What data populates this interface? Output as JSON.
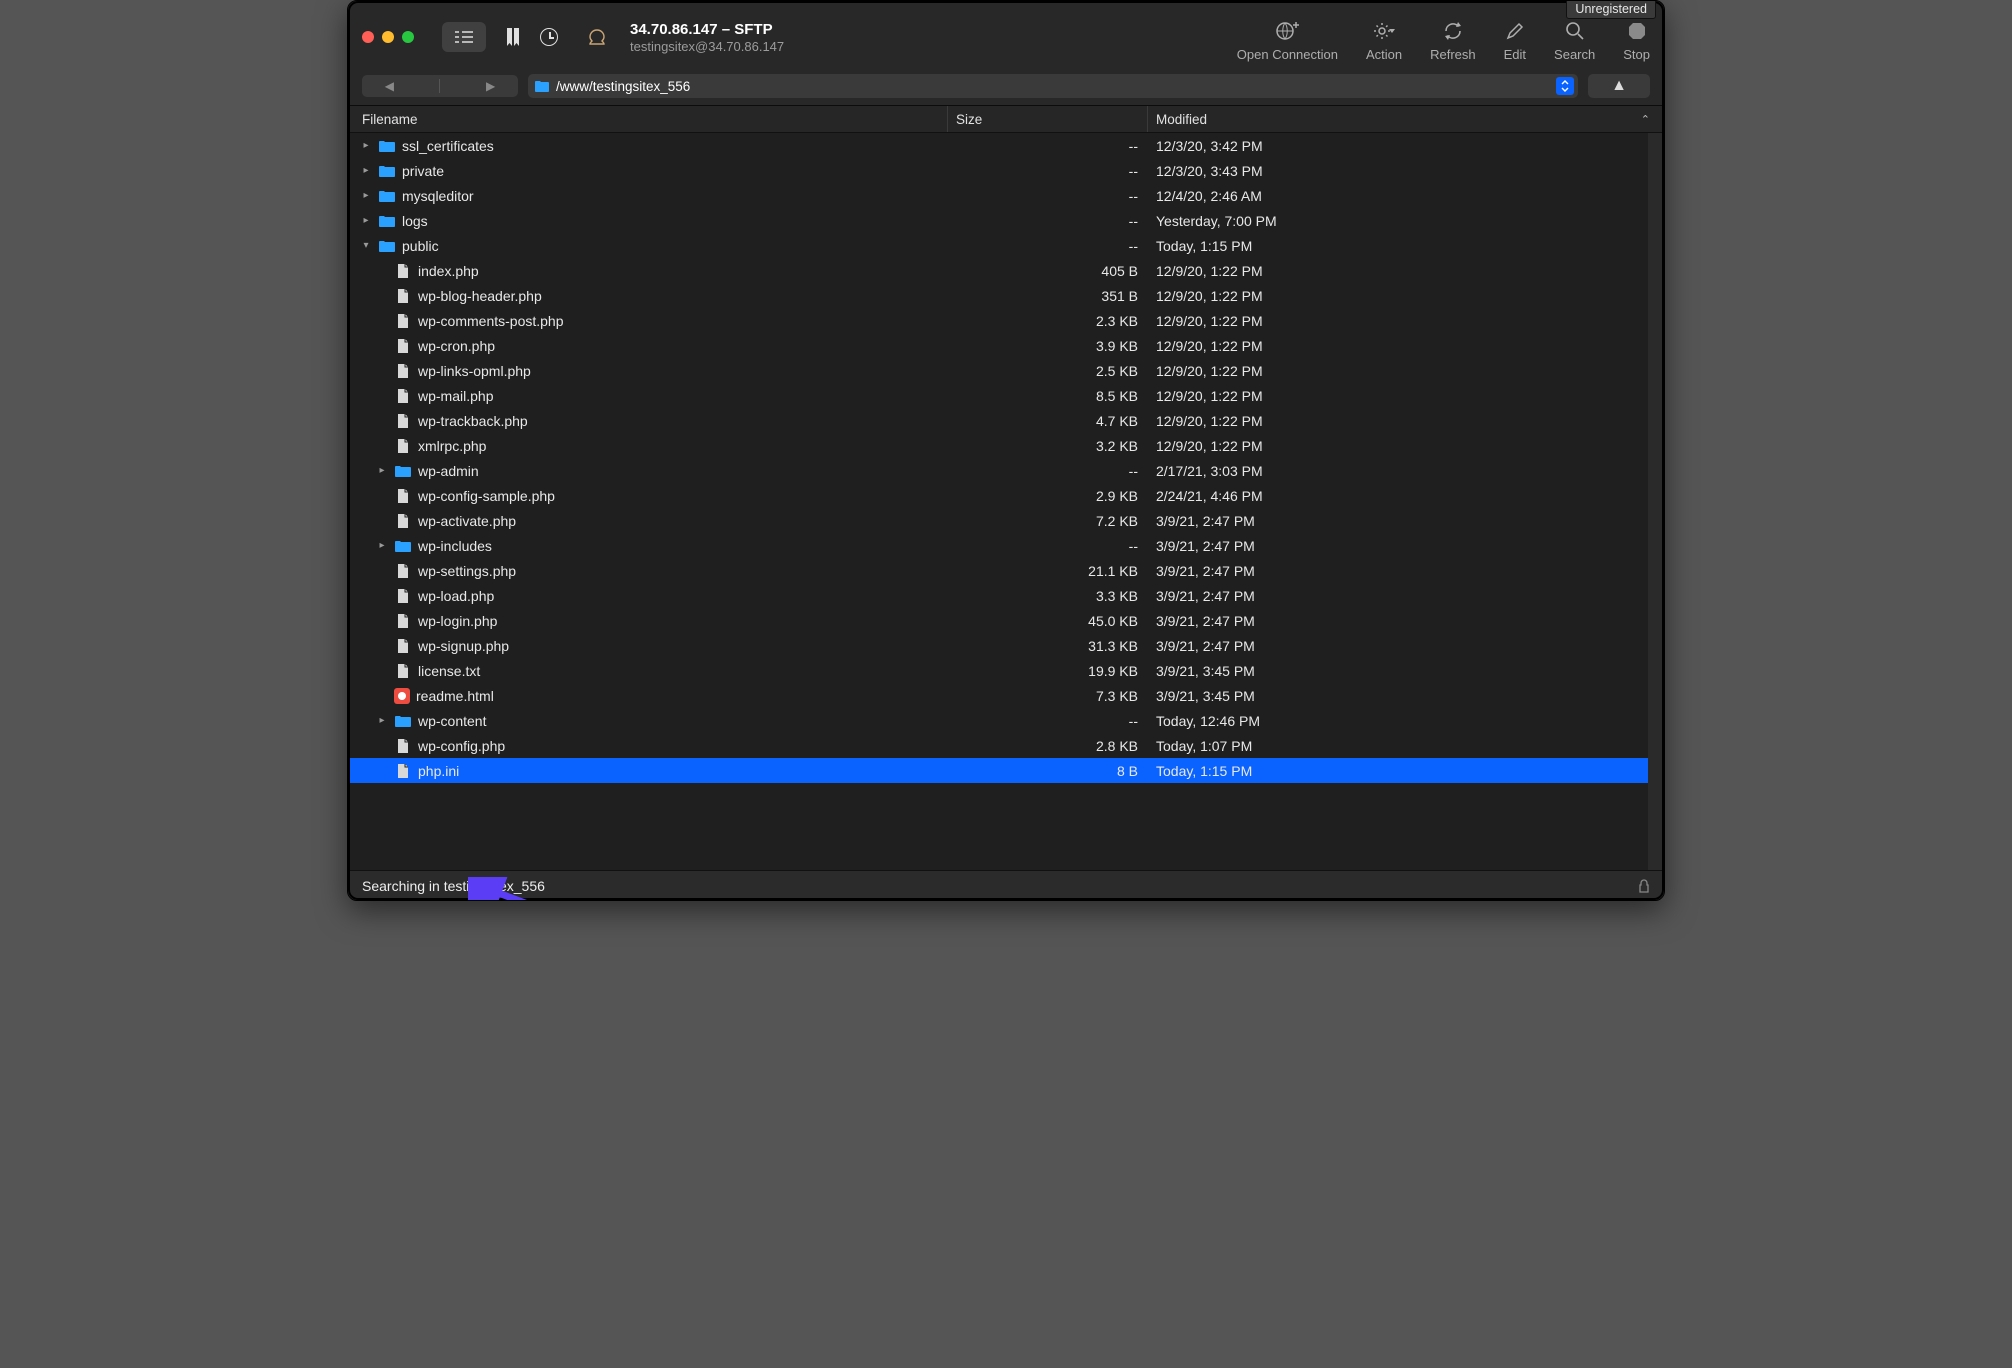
{
  "badge": "Unregistered",
  "header": {
    "title": "34.70.86.147 – SFTP",
    "subtitle": "testingsitex@34.70.86.147"
  },
  "actions": {
    "open_connection": "Open Connection",
    "action": "Action",
    "refresh": "Refresh",
    "edit": "Edit",
    "search": "Search",
    "stop": "Stop"
  },
  "path": "/www/testingsitex_556",
  "columns": {
    "filename": "Filename",
    "size": "Size",
    "modified": "Modified"
  },
  "rows": [
    {
      "type": "folder",
      "depth": 0,
      "expand": "closed",
      "name": "ssl_certificates",
      "size": "--",
      "mod": "12/3/20, 3:42 PM"
    },
    {
      "type": "folder",
      "depth": 0,
      "expand": "closed",
      "name": "private",
      "size": "--",
      "mod": "12/3/20, 3:43 PM"
    },
    {
      "type": "folder",
      "depth": 0,
      "expand": "closed",
      "name": "mysqleditor",
      "size": "--",
      "mod": "12/4/20, 2:46 AM"
    },
    {
      "type": "folder",
      "depth": 0,
      "expand": "closed",
      "name": "logs",
      "size": "--",
      "mod": "Yesterday, 7:00 PM"
    },
    {
      "type": "folder",
      "depth": 0,
      "expand": "open",
      "name": "public",
      "size": "--",
      "mod": "Today, 1:15 PM"
    },
    {
      "type": "file",
      "depth": 1,
      "name": "index.php",
      "size": "405 B",
      "mod": "12/9/20, 1:22 PM"
    },
    {
      "type": "file",
      "depth": 1,
      "name": "wp-blog-header.php",
      "size": "351 B",
      "mod": "12/9/20, 1:22 PM"
    },
    {
      "type": "file",
      "depth": 1,
      "name": "wp-comments-post.php",
      "size": "2.3 KB",
      "mod": "12/9/20, 1:22 PM"
    },
    {
      "type": "file",
      "depth": 1,
      "name": "wp-cron.php",
      "size": "3.9 KB",
      "mod": "12/9/20, 1:22 PM"
    },
    {
      "type": "file",
      "depth": 1,
      "name": "wp-links-opml.php",
      "size": "2.5 KB",
      "mod": "12/9/20, 1:22 PM"
    },
    {
      "type": "file",
      "depth": 1,
      "name": "wp-mail.php",
      "size": "8.5 KB",
      "mod": "12/9/20, 1:22 PM"
    },
    {
      "type": "file",
      "depth": 1,
      "name": "wp-trackback.php",
      "size": "4.7 KB",
      "mod": "12/9/20, 1:22 PM"
    },
    {
      "type": "file",
      "depth": 1,
      "name": "xmlrpc.php",
      "size": "3.2 KB",
      "mod": "12/9/20, 1:22 PM"
    },
    {
      "type": "folder",
      "depth": 1,
      "expand": "closed",
      "name": "wp-admin",
      "size": "--",
      "mod": "2/17/21, 3:03 PM"
    },
    {
      "type": "file",
      "depth": 1,
      "name": "wp-config-sample.php",
      "size": "2.9 KB",
      "mod": "2/24/21, 4:46 PM"
    },
    {
      "type": "file",
      "depth": 1,
      "name": "wp-activate.php",
      "size": "7.2 KB",
      "mod": "3/9/21, 2:47 PM"
    },
    {
      "type": "folder",
      "depth": 1,
      "expand": "closed",
      "name": "wp-includes",
      "size": "--",
      "mod": "3/9/21, 2:47 PM"
    },
    {
      "type": "file",
      "depth": 1,
      "name": "wp-settings.php",
      "size": "21.1 KB",
      "mod": "3/9/21, 2:47 PM"
    },
    {
      "type": "file",
      "depth": 1,
      "name": "wp-load.php",
      "size": "3.3 KB",
      "mod": "3/9/21, 2:47 PM"
    },
    {
      "type": "file",
      "depth": 1,
      "name": "wp-login.php",
      "size": "45.0 KB",
      "mod": "3/9/21, 2:47 PM"
    },
    {
      "type": "file",
      "depth": 1,
      "name": "wp-signup.php",
      "size": "31.3 KB",
      "mod": "3/9/21, 2:47 PM"
    },
    {
      "type": "file",
      "depth": 1,
      "name": "license.txt",
      "size": "19.9 KB",
      "mod": "3/9/21, 3:45 PM"
    },
    {
      "type": "html",
      "depth": 1,
      "name": "readme.html",
      "size": "7.3 KB",
      "mod": "3/9/21, 3:45 PM"
    },
    {
      "type": "folder",
      "depth": 1,
      "expand": "closed",
      "name": "wp-content",
      "size": "--",
      "mod": "Today, 12:46 PM"
    },
    {
      "type": "file",
      "depth": 1,
      "name": "wp-config.php",
      "size": "2.8 KB",
      "mod": "Today, 1:07 PM"
    },
    {
      "type": "file",
      "depth": 1,
      "name": "php.ini",
      "size": "8 B",
      "mod": "Today, 1:15 PM",
      "selected": true
    }
  ],
  "status": "Searching in testingsitex_556"
}
